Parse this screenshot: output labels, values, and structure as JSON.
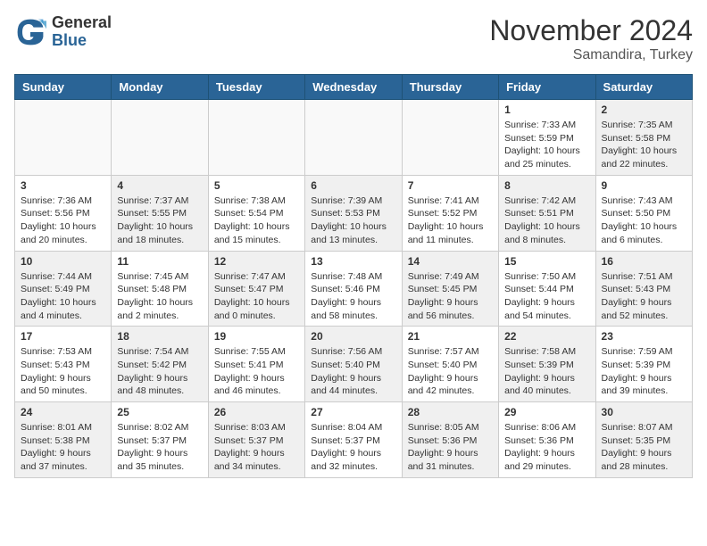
{
  "header": {
    "logo": {
      "general": "General",
      "blue": "Blue"
    },
    "month_title": "November 2024",
    "location": "Samandira, Turkey"
  },
  "weekdays": [
    "Sunday",
    "Monday",
    "Tuesday",
    "Wednesday",
    "Thursday",
    "Friday",
    "Saturday"
  ],
  "weeks": [
    [
      {
        "day": "",
        "info": ""
      },
      {
        "day": "",
        "info": ""
      },
      {
        "day": "",
        "info": ""
      },
      {
        "day": "",
        "info": ""
      },
      {
        "day": "",
        "info": ""
      },
      {
        "day": "1",
        "info": "Sunrise: 7:33 AM\nSunset: 5:59 PM\nDaylight: 10 hours and 25 minutes."
      },
      {
        "day": "2",
        "info": "Sunrise: 7:35 AM\nSunset: 5:58 PM\nDaylight: 10 hours and 22 minutes."
      }
    ],
    [
      {
        "day": "3",
        "info": "Sunrise: 7:36 AM\nSunset: 5:56 PM\nDaylight: 10 hours and 20 minutes."
      },
      {
        "day": "4",
        "info": "Sunrise: 7:37 AM\nSunset: 5:55 PM\nDaylight: 10 hours and 18 minutes."
      },
      {
        "day": "5",
        "info": "Sunrise: 7:38 AM\nSunset: 5:54 PM\nDaylight: 10 hours and 15 minutes."
      },
      {
        "day": "6",
        "info": "Sunrise: 7:39 AM\nSunset: 5:53 PM\nDaylight: 10 hours and 13 minutes."
      },
      {
        "day": "7",
        "info": "Sunrise: 7:41 AM\nSunset: 5:52 PM\nDaylight: 10 hours and 11 minutes."
      },
      {
        "day": "8",
        "info": "Sunrise: 7:42 AM\nSunset: 5:51 PM\nDaylight: 10 hours and 8 minutes."
      },
      {
        "day": "9",
        "info": "Sunrise: 7:43 AM\nSunset: 5:50 PM\nDaylight: 10 hours and 6 minutes."
      }
    ],
    [
      {
        "day": "10",
        "info": "Sunrise: 7:44 AM\nSunset: 5:49 PM\nDaylight: 10 hours and 4 minutes."
      },
      {
        "day": "11",
        "info": "Sunrise: 7:45 AM\nSunset: 5:48 PM\nDaylight: 10 hours and 2 minutes."
      },
      {
        "day": "12",
        "info": "Sunrise: 7:47 AM\nSunset: 5:47 PM\nDaylight: 10 hours and 0 minutes."
      },
      {
        "day": "13",
        "info": "Sunrise: 7:48 AM\nSunset: 5:46 PM\nDaylight: 9 hours and 58 minutes."
      },
      {
        "day": "14",
        "info": "Sunrise: 7:49 AM\nSunset: 5:45 PM\nDaylight: 9 hours and 56 minutes."
      },
      {
        "day": "15",
        "info": "Sunrise: 7:50 AM\nSunset: 5:44 PM\nDaylight: 9 hours and 54 minutes."
      },
      {
        "day": "16",
        "info": "Sunrise: 7:51 AM\nSunset: 5:43 PM\nDaylight: 9 hours and 52 minutes."
      }
    ],
    [
      {
        "day": "17",
        "info": "Sunrise: 7:53 AM\nSunset: 5:43 PM\nDaylight: 9 hours and 50 minutes."
      },
      {
        "day": "18",
        "info": "Sunrise: 7:54 AM\nSunset: 5:42 PM\nDaylight: 9 hours and 48 minutes."
      },
      {
        "day": "19",
        "info": "Sunrise: 7:55 AM\nSunset: 5:41 PM\nDaylight: 9 hours and 46 minutes."
      },
      {
        "day": "20",
        "info": "Sunrise: 7:56 AM\nSunset: 5:40 PM\nDaylight: 9 hours and 44 minutes."
      },
      {
        "day": "21",
        "info": "Sunrise: 7:57 AM\nSunset: 5:40 PM\nDaylight: 9 hours and 42 minutes."
      },
      {
        "day": "22",
        "info": "Sunrise: 7:58 AM\nSunset: 5:39 PM\nDaylight: 9 hours and 40 minutes."
      },
      {
        "day": "23",
        "info": "Sunrise: 7:59 AM\nSunset: 5:39 PM\nDaylight: 9 hours and 39 minutes."
      }
    ],
    [
      {
        "day": "24",
        "info": "Sunrise: 8:01 AM\nSunset: 5:38 PM\nDaylight: 9 hours and 37 minutes."
      },
      {
        "day": "25",
        "info": "Sunrise: 8:02 AM\nSunset: 5:37 PM\nDaylight: 9 hours and 35 minutes."
      },
      {
        "day": "26",
        "info": "Sunrise: 8:03 AM\nSunset: 5:37 PM\nDaylight: 9 hours and 34 minutes."
      },
      {
        "day": "27",
        "info": "Sunrise: 8:04 AM\nSunset: 5:37 PM\nDaylight: 9 hours and 32 minutes."
      },
      {
        "day": "28",
        "info": "Sunrise: 8:05 AM\nSunset: 5:36 PM\nDaylight: 9 hours and 31 minutes."
      },
      {
        "day": "29",
        "info": "Sunrise: 8:06 AM\nSunset: 5:36 PM\nDaylight: 9 hours and 29 minutes."
      },
      {
        "day": "30",
        "info": "Sunrise: 8:07 AM\nSunset: 5:35 PM\nDaylight: 9 hours and 28 minutes."
      }
    ]
  ]
}
